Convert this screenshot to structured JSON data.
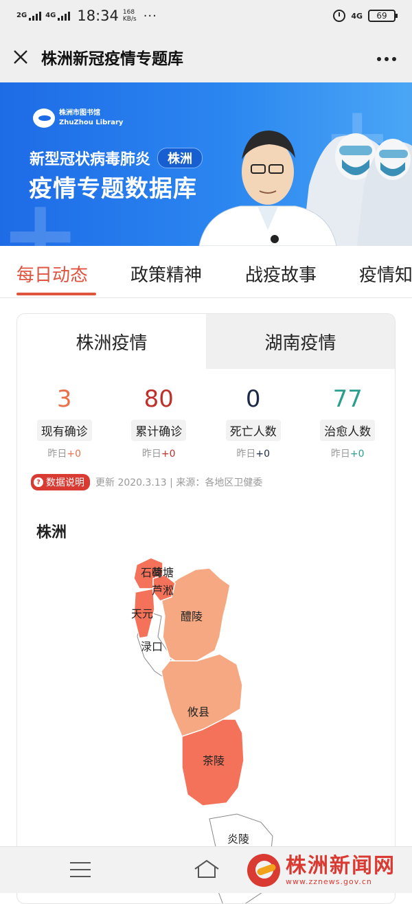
{
  "status_bar": {
    "sim1": "2G",
    "sim2": "4G",
    "time": "18:34",
    "speed_value": "168",
    "speed_unit": "KB/s",
    "more": "···",
    "net": "4G",
    "battery": "69"
  },
  "header": {
    "close_icon": "close-icon",
    "title": "株洲新冠疫情专题库",
    "more_icon": "more-icon"
  },
  "banner": {
    "logo_text": "株洲市图书馆",
    "logo_sub": "ZhuZhou Library",
    "line1": "新型冠状病毒肺炎",
    "tag": "株洲",
    "line2": "疫情专题数据库"
  },
  "tabs": [
    "每日动态",
    "政策精神",
    "战疫故事",
    "疫情知"
  ],
  "subtabs": [
    "株洲疫情",
    "湖南疫情"
  ],
  "stats": [
    {
      "value": "3",
      "label": "现有确诊",
      "delta_prefix": "昨日",
      "delta": "+0",
      "color": "#e8704a"
    },
    {
      "value": "80",
      "label": "累计确诊",
      "delta_prefix": "昨日",
      "delta": "+0",
      "color": "#c0302a"
    },
    {
      "value": "0",
      "label": "死亡人数",
      "delta_prefix": "昨日",
      "delta": "+0",
      "color": "#1c2a4a"
    },
    {
      "value": "77",
      "label": "治愈人数",
      "delta_prefix": "昨日",
      "delta": "+0",
      "color": "#2a9d8f"
    }
  ],
  "source": {
    "badge": "数据说明",
    "text": "更新 2020.3.13 | 来源：各地区卫健委"
  },
  "map": {
    "title": "株洲",
    "regions": [
      "石峰",
      "荷塘",
      "芦淞",
      "天元",
      "醴陵",
      "渌口",
      "攸县",
      "茶陵",
      "炎陵"
    ]
  },
  "bottom": {
    "menu_icon": "menu-icon",
    "home_icon": "home-icon",
    "brand_name": "株洲新闻网",
    "brand_url": "www.zznews.gov.cn"
  }
}
